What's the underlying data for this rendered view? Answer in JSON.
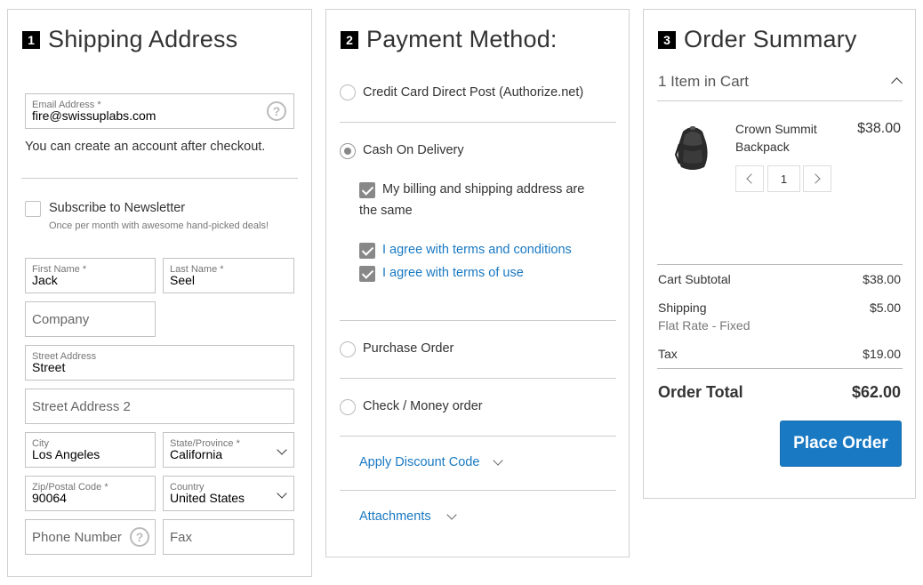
{
  "shipping": {
    "step": "1",
    "title": "Shipping Address",
    "email_label": "Email Address *",
    "email_value": "fire@swissuplabs.com",
    "account_note": "You can create an account after checkout.",
    "newsletter_label": "Subscribe to Newsletter",
    "newsletter_note": "Once per month with awesome hand-picked deals!",
    "first_name_label": "First Name *",
    "first_name_value": "Jack",
    "last_name_label": "Last Name *",
    "last_name_value": "Seel",
    "company_placeholder": "Company",
    "street_label": "Street Address",
    "street_value": "Street",
    "street2_placeholder": "Street Address 2",
    "city_label": "City",
    "city_value": "Los Angeles",
    "state_label": "State/Province *",
    "state_value": "California",
    "zip_label": "Zip/Postal Code *",
    "zip_value": "90064",
    "country_label": "Country",
    "country_value": "United States",
    "phone_placeholder": "Phone Number",
    "fax_placeholder": "Fax",
    "help_glyph": "?"
  },
  "payment": {
    "step": "2",
    "title": "Payment Method:",
    "methods": [
      {
        "label": "Credit Card Direct Post (Authorize.net)",
        "selected": false
      },
      {
        "label": "Cash On Delivery",
        "selected": true
      },
      {
        "label": "Purchase Order",
        "selected": false
      },
      {
        "label": "Check / Money order",
        "selected": false
      }
    ],
    "billing_same_line1": "My billing and shipping address are",
    "billing_same_line2": "the same",
    "agree_terms_conditions": "I agree with terms and conditions",
    "agree_terms_use": "I agree with terms of use",
    "discount_label": "Apply Discount Code",
    "attachments_label": "Attachments"
  },
  "summary": {
    "step": "3",
    "title": "Order Summary",
    "items_in_cart": "1 Item in Cart",
    "product_name_line1": "Crown Summit",
    "product_name_line2": "Backpack",
    "product_price": "$38.00",
    "product_qty": "1",
    "cart_subtotal_label": "Cart Subtotal",
    "cart_subtotal_value": "$38.00",
    "shipping_label": "Shipping",
    "shipping_method": "Flat Rate - Fixed",
    "shipping_value": "$5.00",
    "tax_label": "Tax",
    "tax_value": "$19.00",
    "order_total_label": "Order Total",
    "order_total_value": "$62.00",
    "place_order_label": "Place Order"
  },
  "colors": {
    "accent": "#1979c3",
    "link": "#1979c3",
    "border": "#d1d1d1"
  },
  "icons": {
    "help": "question-circle-icon",
    "dropdown": "chevron-down-icon",
    "collapse": "chevron-up-icon",
    "product": "backpack-image"
  }
}
